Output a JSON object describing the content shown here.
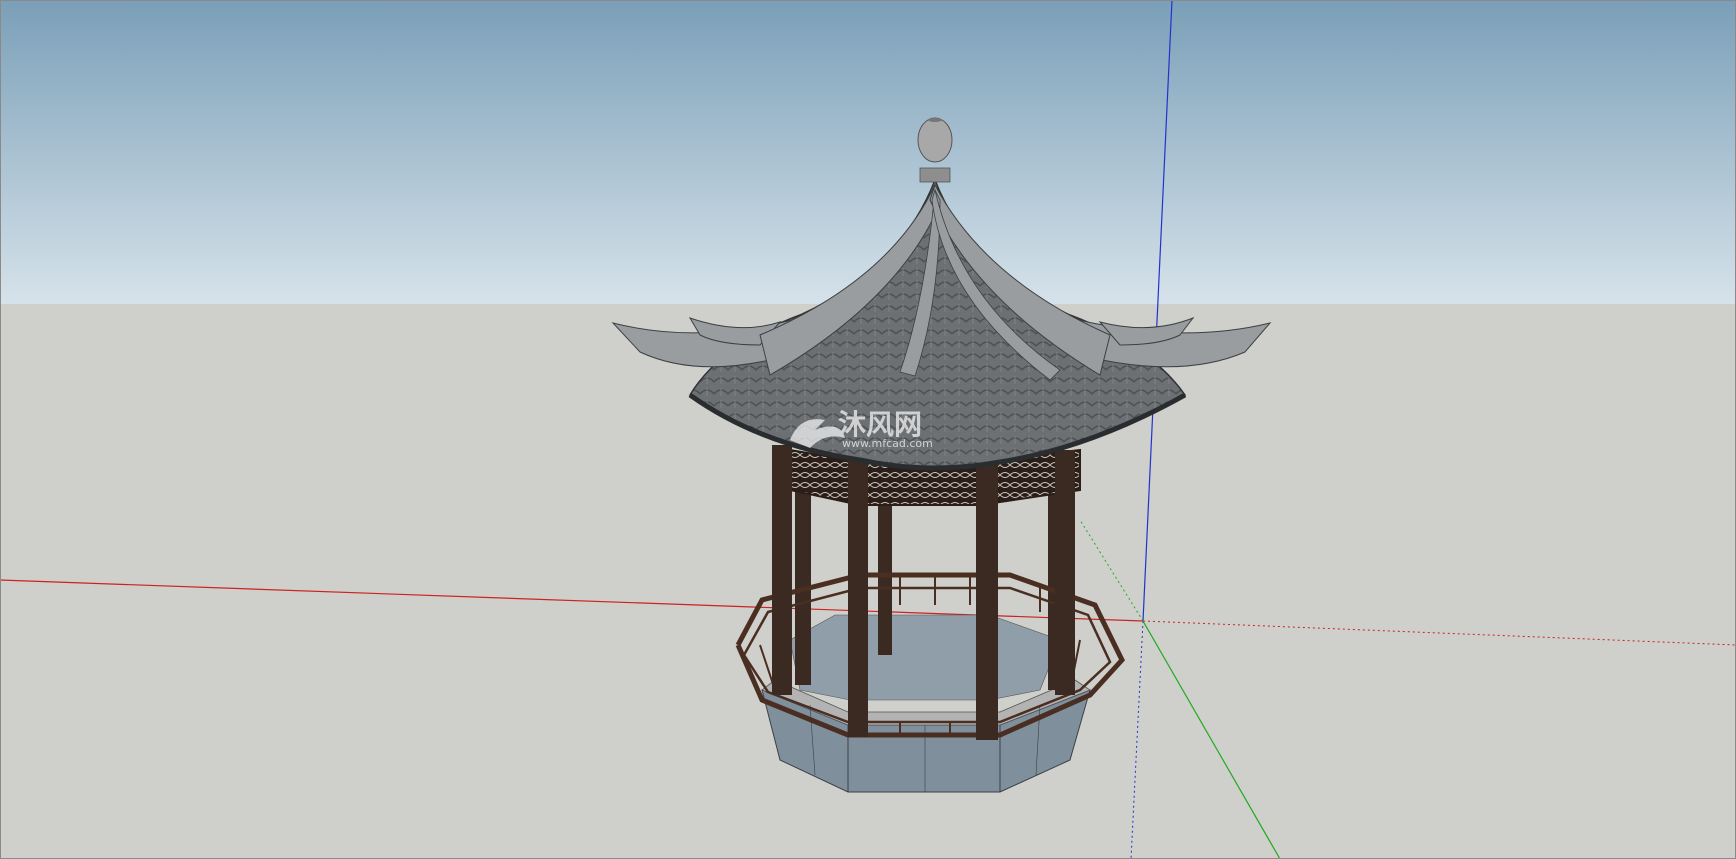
{
  "viewport": {
    "sky_top_color": "#7a9fb8",
    "sky_bottom_color": "#d6e2ea",
    "ground_color": "#cfcfcb",
    "frame_color": "#8a8a8a"
  },
  "axes": {
    "x_axis_color": "#cc2222",
    "y_axis_color": "#22aa22",
    "z_axis_color": "#2233cc"
  },
  "model": {
    "name_icon": "hexagonal-pavilion-icon",
    "roof_color": "#6d7073",
    "ridge_color": "#9a9d9f",
    "finial_color": "#a8a8a8",
    "pillar_color": "#3a2a22",
    "rail_color": "#4a2e22",
    "base_color": "#7f8f9c",
    "base_top_color": "#b3b3b3"
  },
  "watermark": {
    "brand": "沐风网",
    "url": "www.mfcad.com"
  }
}
